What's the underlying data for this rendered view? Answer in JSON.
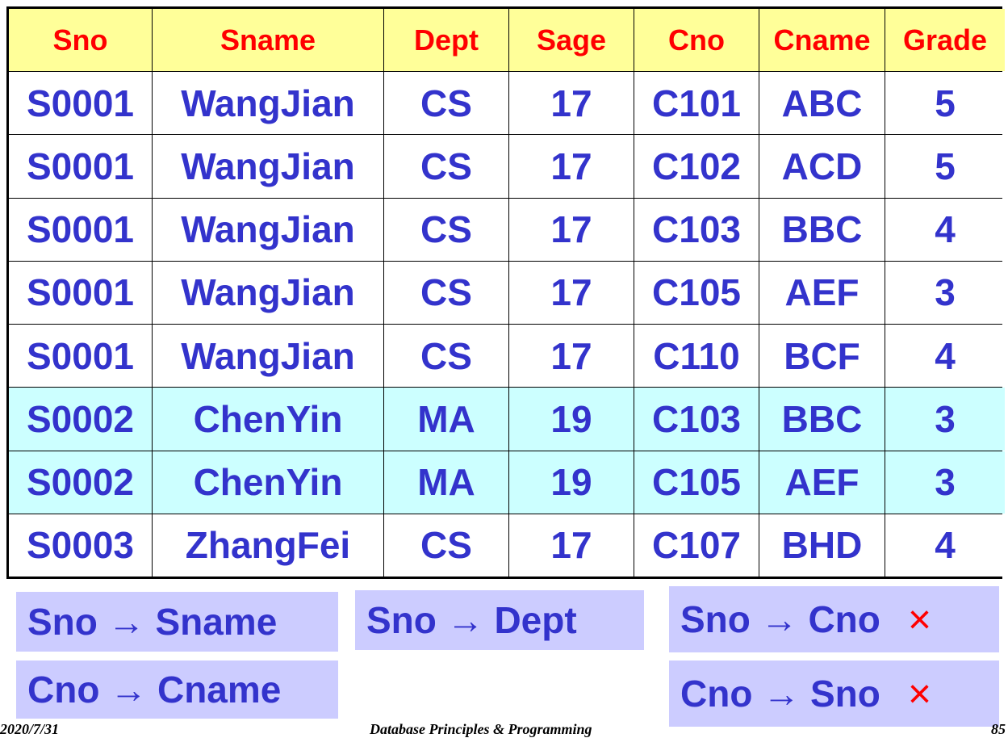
{
  "table": {
    "columns": [
      "Sno",
      "Sname",
      "Dept",
      "Sage",
      "Cno",
      "Cname",
      "Grade"
    ],
    "rows": [
      {
        "cells": [
          "S0001",
          "WangJian",
          "CS",
          "17",
          "C101",
          "ABC",
          "5"
        ],
        "highlight": false
      },
      {
        "cells": [
          "S0001",
          "WangJian",
          "CS",
          "17",
          "C102",
          "ACD",
          "5"
        ],
        "highlight": false
      },
      {
        "cells": [
          "S0001",
          "WangJian",
          "CS",
          "17",
          "C103",
          "BBC",
          "4"
        ],
        "highlight": false
      },
      {
        "cells": [
          "S0001",
          "WangJian",
          "CS",
          "17",
          "C105",
          "AEF",
          "3"
        ],
        "highlight": false
      },
      {
        "cells": [
          "S0001",
          "WangJian",
          "CS",
          "17",
          "C110",
          "BCF",
          "4"
        ],
        "highlight": false
      },
      {
        "cells": [
          "S0002",
          "ChenYin",
          "MA",
          "19",
          "C103",
          "BBC",
          "3"
        ],
        "highlight": true
      },
      {
        "cells": [
          "S0002",
          "ChenYin",
          "MA",
          "19",
          "C105",
          "AEF",
          "3"
        ],
        "highlight": true
      },
      {
        "cells": [
          "S0003",
          "ZhangFei",
          "CS",
          "17",
          "C107",
          "BHD",
          "4"
        ],
        "highlight": false
      }
    ]
  },
  "dependencies": [
    {
      "text": "Sno → Sname",
      "valid": true
    },
    {
      "text": "Sno → Dept",
      "valid": true
    },
    {
      "text": "Sno → Cno",
      "valid": false
    },
    {
      "text": "Cno → Cname",
      "valid": true
    },
    {
      "text": "Cno → Sno",
      "valid": false
    }
  ],
  "invalid_mark": "×",
  "footer": {
    "date": "2020/7/31",
    "course": "Database Principles & Programming",
    "page": "85"
  },
  "colors": {
    "header_bg": "#ffff99",
    "header_text": "#ff0000",
    "cell_text": "#3333cc",
    "highlight_bg": "#ccffff",
    "fd_bg": "#ccccff",
    "invalid": "#ff0000"
  }
}
